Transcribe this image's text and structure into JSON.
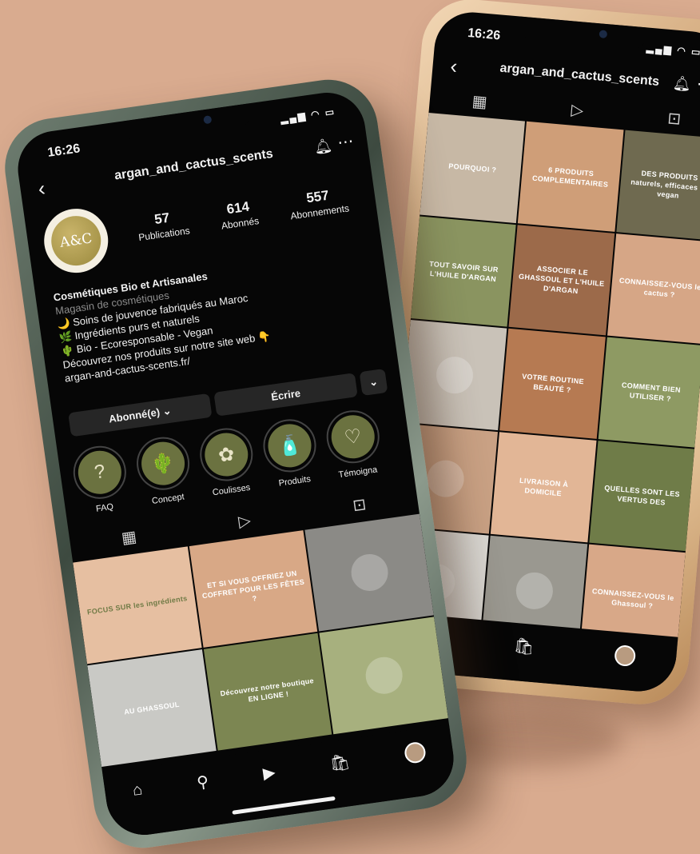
{
  "status_time": "16:26",
  "front": {
    "username": "argan_and_cactus_scents",
    "avatar_text": "A&C",
    "stats": [
      {
        "value": "57",
        "label": "Publications"
      },
      {
        "value": "614",
        "label": "Abonnés"
      },
      {
        "value": "557",
        "label": "Abonnements"
      }
    ],
    "bio": {
      "name": "Cosmétiques Bio et Artisanales",
      "category": "Magasin de cosmétiques",
      "lines": [
        "🌙 Soins de jouvence fabriqués au Maroc",
        "🌿 Ingrédients purs et naturels",
        "🌵 Bio - Ecoresponsable - Vegan",
        "Découvrez nos produits sur notre site web 👇",
        "argan-and-cactus-scents.fr/"
      ]
    },
    "actions": {
      "follow": "Abonné(e) ⌄",
      "message": "Écrire",
      "more": "⌄"
    },
    "highlights": [
      {
        "label": "FAQ",
        "glyph": "?"
      },
      {
        "label": "Concept",
        "glyph": "🌵"
      },
      {
        "label": "Coulisses",
        "glyph": "✿"
      },
      {
        "label": "Produits",
        "glyph": "🧴"
      },
      {
        "label": "Témoigna",
        "glyph": "♡"
      }
    ],
    "tiles": [
      {
        "text": "FOCUS SUR les ingrédients",
        "bg": "#e6bfa1",
        "fg": "#6f7a45"
      },
      {
        "text": "ET SI VOUS OFFRIEZ UN COFFRET POUR LES FÊTES ?",
        "bg": "#d8a886",
        "fg": "#fff"
      },
      {
        "text": "",
        "bg": "#8b8a86",
        "fg": "#fff"
      },
      {
        "text": "AU GHASSOUL",
        "bg": "#c9c9c5",
        "fg": "#fff"
      },
      {
        "text": "Découvrez notre boutique EN LIGNE !",
        "bg": "#7c8652",
        "fg": "#fff"
      },
      {
        "text": "",
        "bg": "#a7b07e",
        "fg": "#fff"
      }
    ]
  },
  "back": {
    "username": "argan_and_cactus_scents",
    "tiles": [
      {
        "text": "POURQUOI ?",
        "bg": "#c7b8a5",
        "fg": "#fff"
      },
      {
        "text": "6 PRODUITS COMPLEMENTAIRES",
        "bg": "#cf9e78",
        "fg": "#fff"
      },
      {
        "text": "DES PRODUITS naturels, efficaces et vegan",
        "bg": "#6f6a50",
        "fg": "#fff"
      },
      {
        "text": "TOUT SAVOIR SUR L'HUILE D'ARGAN",
        "bg": "#8a9460",
        "fg": "#fff"
      },
      {
        "text": "ASSOCIER LE GHASSOUL ET L'HUILE D'ARGAN",
        "bg": "#9c6a4a",
        "fg": "#fff"
      },
      {
        "text": "CONNAISSEZ-VOUS le cactus ?",
        "bg": "#d6a686",
        "fg": "#fff"
      },
      {
        "text": "",
        "bg": "#c9c2b8",
        "fg": "#fff"
      },
      {
        "text": "VOTRE ROUTINE BEAUTÉ ?",
        "bg": "#b67a52",
        "fg": "#fff"
      },
      {
        "text": "COMMENT BIEN UTILISER ?",
        "bg": "#8e9a63",
        "fg": "#fff"
      },
      {
        "text": "",
        "bg": "#c9a184",
        "fg": "#fff"
      },
      {
        "text": "LIVRAISON À DOMICILE",
        "bg": "#e2b696",
        "fg": "#fff"
      },
      {
        "text": "QUELLES SONT LES VERTUS DES",
        "bg": "#6f7c48",
        "fg": "#fff"
      },
      {
        "text": "",
        "bg": "#d9d7d2",
        "fg": "#fff"
      },
      {
        "text": "",
        "bg": "#9a9890",
        "fg": "#fff"
      },
      {
        "text": "CONNAISSEZ-VOUS le Ghassoul ?",
        "bg": "#d8a888",
        "fg": "#fff"
      }
    ]
  }
}
